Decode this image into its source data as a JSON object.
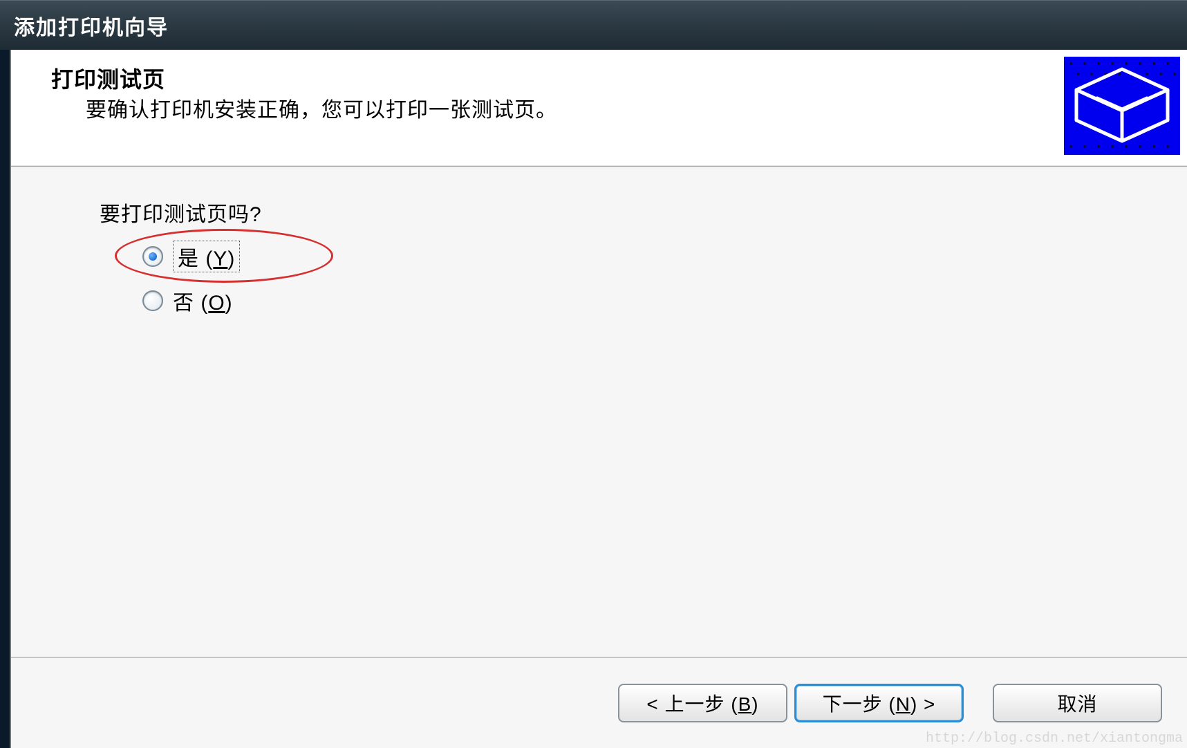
{
  "title_bar": {
    "title": "添加打印机向导"
  },
  "header": {
    "title": "打印测试页",
    "subtitle": "要确认打印机安装正确，您可以打印一张测试页。"
  },
  "body": {
    "prompt": "要打印测试页吗?",
    "radios": {
      "yes": {
        "prefix": "是 (",
        "mnemonic": "Y",
        "suffix": ")",
        "checked": true,
        "focused": true
      },
      "no": {
        "prefix": "否 (",
        "mnemonic": "O",
        "suffix": ")",
        "checked": false,
        "focused": false
      }
    }
  },
  "footer": {
    "back": {
      "lead": "< 上一步 (",
      "mnemonic": "B",
      "tail": ")"
    },
    "next": {
      "lead": "下一步 (",
      "mnemonic": "N",
      "tail": ") >"
    },
    "cancel": {
      "label": "取消"
    }
  },
  "watermark": "http://blog.csdn.net/xiantongma",
  "colors": {
    "titlebar_bg": "#2c3a44",
    "accent_border": "#2a8dd6",
    "highlight_ellipse": "#d62f2f"
  }
}
